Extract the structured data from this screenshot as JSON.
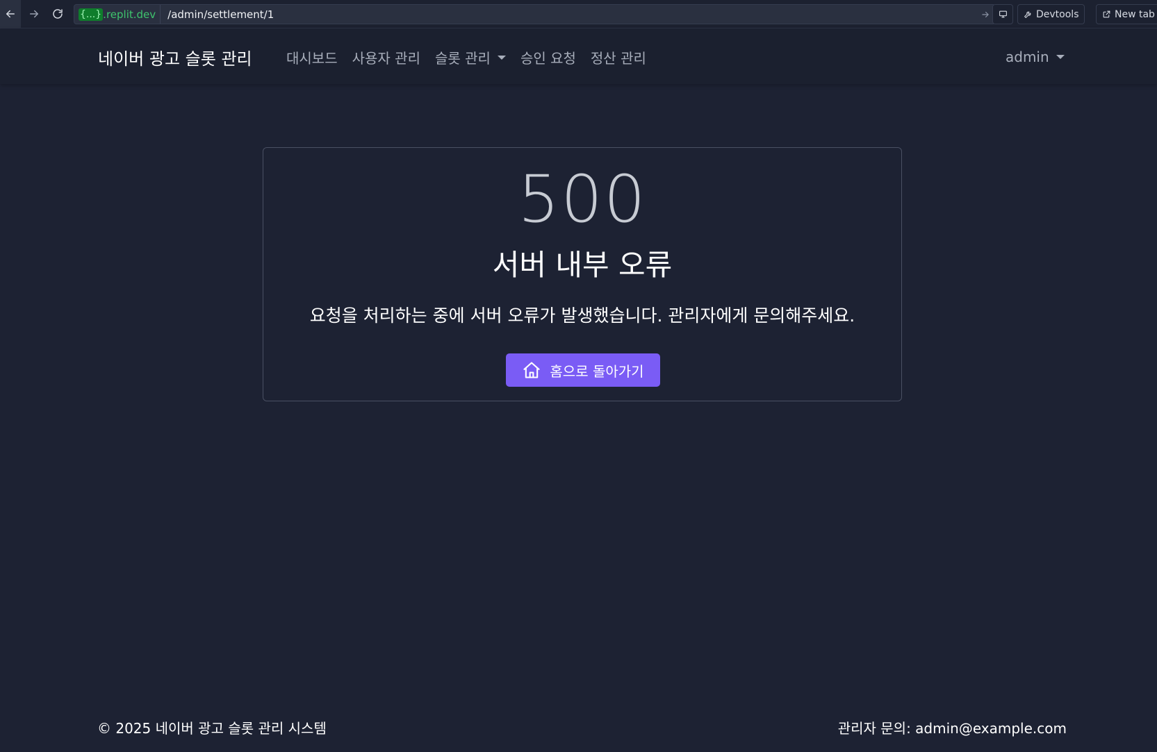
{
  "browser": {
    "domain_tag": "{...}",
    "domain_suffix": ".replit.dev",
    "path": "/admin/settlement/1",
    "devtools_label": "Devtools",
    "newtab_label": "New tab"
  },
  "nav": {
    "brand": "네이버 광고 슬롯 관리",
    "items": [
      {
        "label": "대시보드"
      },
      {
        "label": "사용자 관리"
      },
      {
        "label": "슬롯 관리"
      },
      {
        "label": "승인 요청"
      },
      {
        "label": "정산 관리"
      }
    ],
    "user": "admin"
  },
  "error": {
    "code": "500",
    "title": "서버 내부 오류",
    "message": "요청을 처리하는 중에 서버 오류가 발생했습니다. 관리자에게 문의해주세요.",
    "button_label": "홈으로 돌아가기"
  },
  "footer": {
    "copyright": "© 2025 네이버 광고 슬롯 관리 시스템",
    "contact_label": "관리자 문의: ",
    "contact_email": "admin@example.com"
  },
  "colors": {
    "background": "#1d2233",
    "navbar": "#1b202f",
    "accent": "#7a5cf5",
    "domain_green": "#3ec46d"
  },
  "icons": {
    "back": "arrow-left-icon",
    "forward": "arrow-right-icon",
    "reload": "reload-icon",
    "go": "arrow-right-icon",
    "screen": "monitor-icon",
    "devtools": "wrench-icon",
    "newtab": "external-link-icon",
    "home": "home-icon"
  }
}
